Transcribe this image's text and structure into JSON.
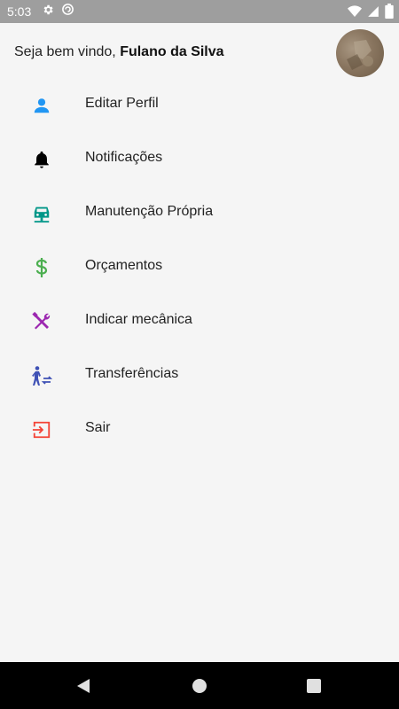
{
  "status_bar": {
    "time": "5:03"
  },
  "header": {
    "greeting": "Seja bem vindo, ",
    "user_name": "Fulano da Silva"
  },
  "menu": {
    "items": [
      {
        "label": "Editar Perfil",
        "icon": "person-icon",
        "color": "#2196f3"
      },
      {
        "label": "Notificações",
        "icon": "bell-icon",
        "color": "#000000"
      },
      {
        "label": "Manutenção Própria",
        "icon": "car-icon",
        "color": "#009688"
      },
      {
        "label": "Orçamentos",
        "icon": "dollar-icon",
        "color": "#4caf50"
      },
      {
        "label": "Indicar mecânica",
        "icon": "tools-icon",
        "color": "#9c27b0"
      },
      {
        "label": "Transferências",
        "icon": "transfer-icon",
        "color": "#3f51b5"
      },
      {
        "label": "Sair",
        "icon": "exit-icon",
        "color": "#f44336"
      }
    ]
  }
}
